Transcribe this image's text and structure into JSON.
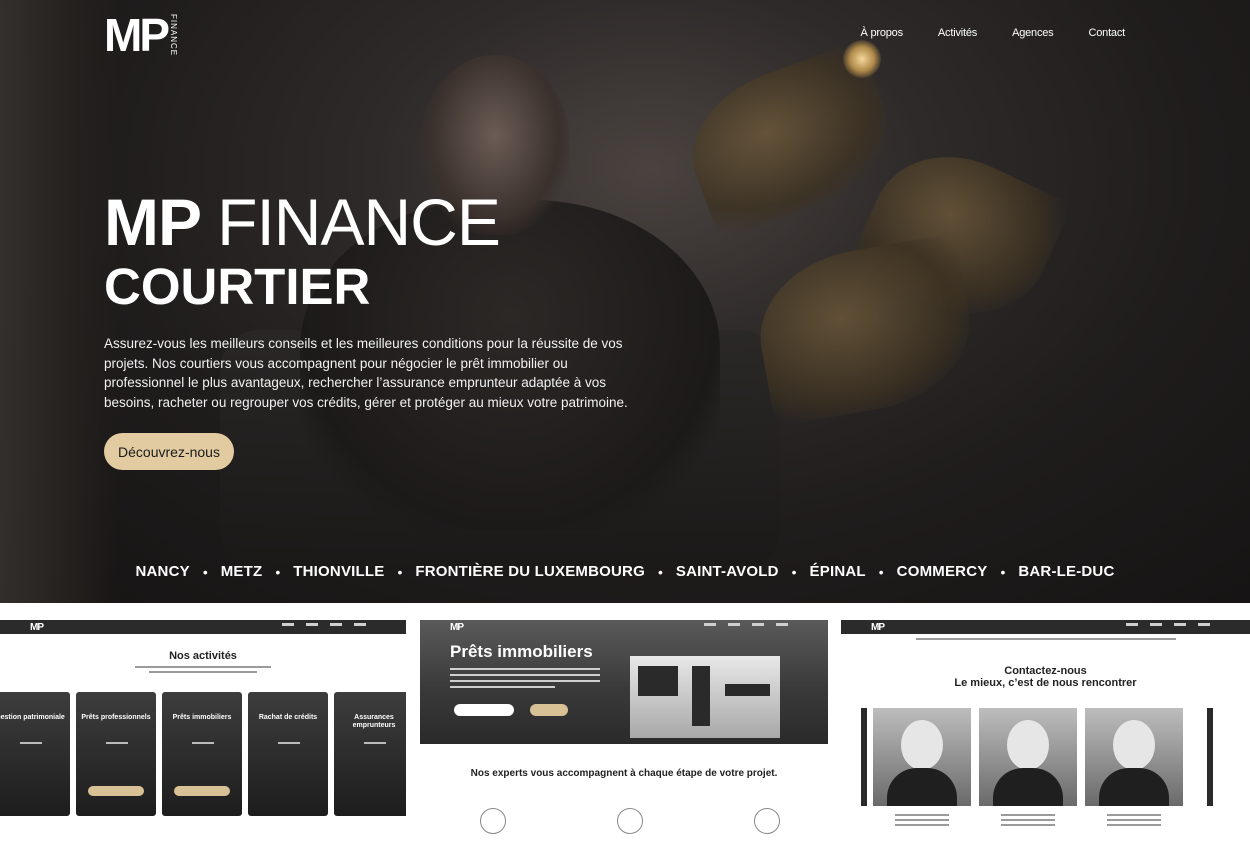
{
  "logo": {
    "mark": "MP",
    "word": "FINANCE"
  },
  "nav": [
    "À propos",
    "Activités",
    "Agences",
    "Contact"
  ],
  "hero": {
    "title_bold": "MP",
    "title_light": "FINANCE",
    "subtitle": "COURTIER",
    "text": "Assurez-vous les meilleurs conseils et les meilleures conditions pour la réussite de vos projets. Nos courtiers vous accompagnent pour négocier le prêt immobilier ou professionnel le plus avantageux, rechercher l’assurance emprunteur adaptée à vos besoins, racheter ou regrouper vos crédits, gérer et protéger au mieux votre patrimoine.",
    "cta": "Découvrez-nous"
  },
  "cities": [
    "NANCY",
    "METZ",
    "THIONVILLE",
    "FRONTIÈRE DU LUXEMBOURG",
    "SAINT-AVOLD",
    "ÉPINAL",
    "COMMERCY",
    "BAR-LE-DUC"
  ],
  "thumbnails": {
    "activities": {
      "logo": "MP",
      "title": "Nos activités",
      "cards": [
        "Gestion patrimoniale",
        "Prêts professionnels",
        "Prêts immobiliers",
        "Rachat de crédits",
        "Assurances emprunteurs"
      ]
    },
    "loans": {
      "logo": "MP",
      "title": "Prêts immobiliers",
      "section": "Nos experts vous accompagnent à chaque étape de votre projet."
    },
    "contact": {
      "logo": "MP",
      "title": "Contactez-nous",
      "subtitle": "Le mieux, c’est de nous rencontrer"
    }
  },
  "colors": {
    "accent": "#e2cba0",
    "hero_bg": "#1f1c1c",
    "text": "#ffffff"
  }
}
